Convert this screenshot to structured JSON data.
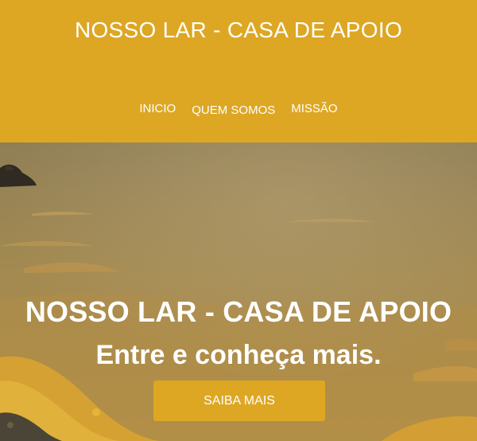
{
  "header": {
    "site_title": "NOSSO LAR - CASA DE APOIO",
    "nav": [
      {
        "label": "INICIO"
      },
      {
        "label": "QUEM SOMOS"
      },
      {
        "label": "MISSÃO"
      }
    ]
  },
  "hero": {
    "title": "NOSSO LAR - CASA DE APOIO",
    "subtitle": "Entre e conheça mais.",
    "button_label": "SAIBA MAIS"
  },
  "colors": {
    "brand_yellow": "#dda724",
    "text_white": "#ffffff"
  }
}
